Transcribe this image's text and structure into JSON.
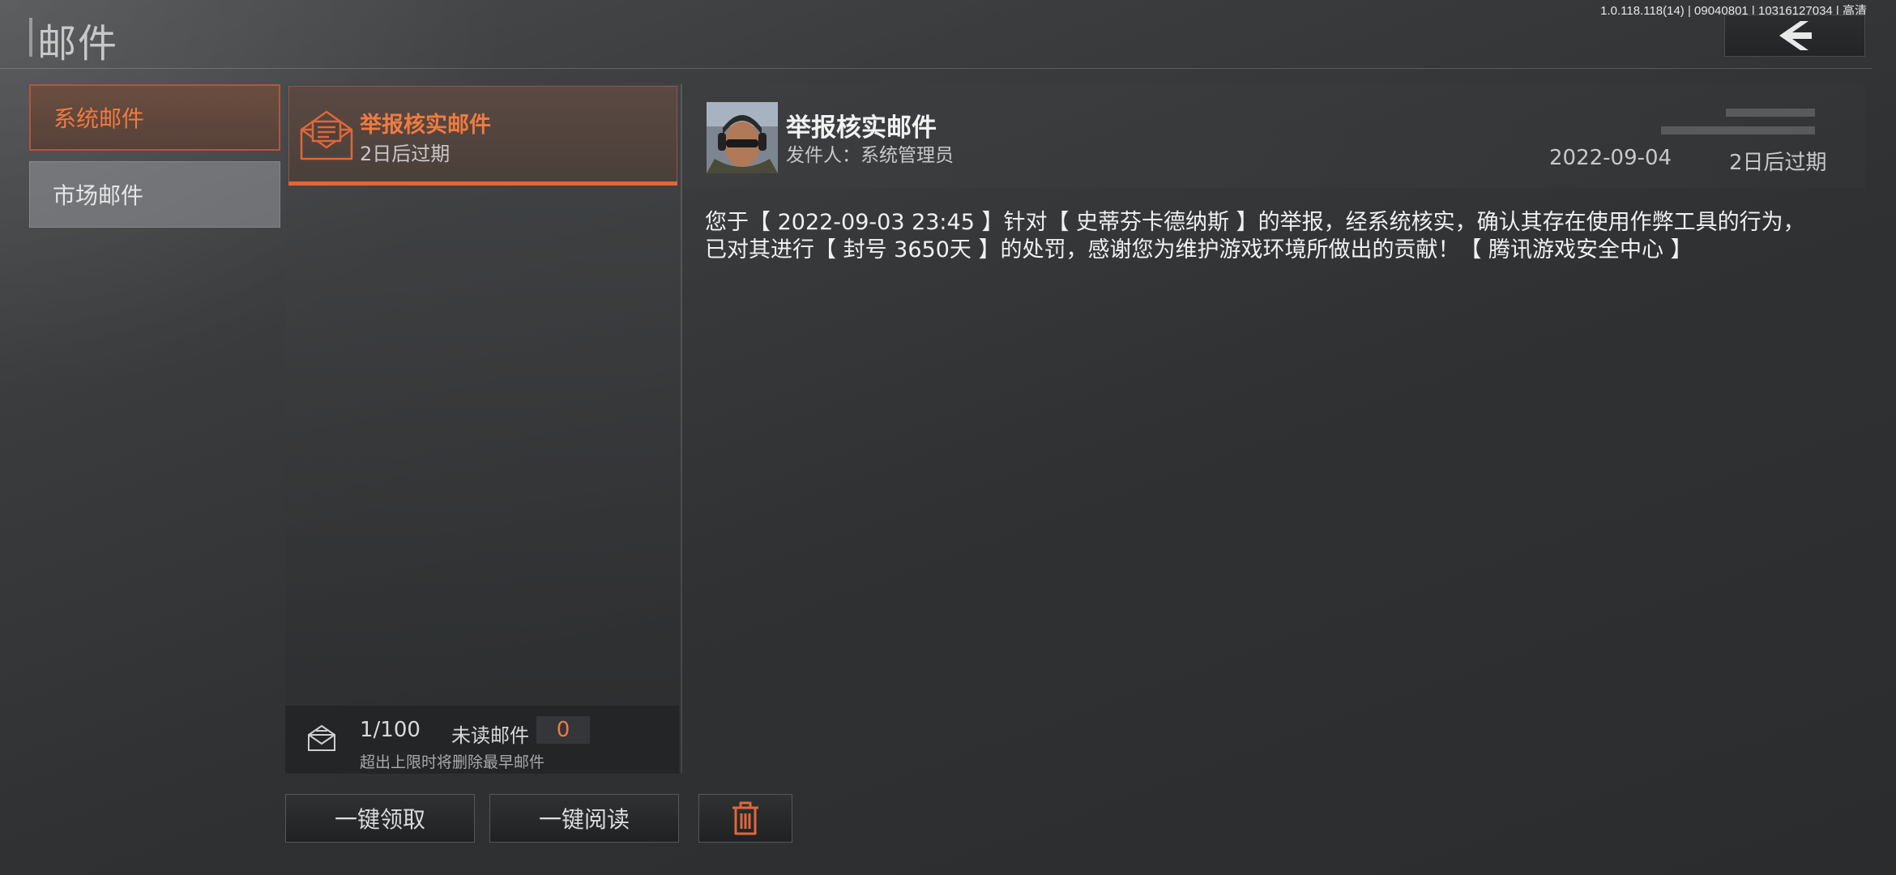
{
  "header": {
    "title": "邮件",
    "version": "1.0.118.118(14) | 09040801 | 10316127034 | 高清",
    "back_icon": "chevron-left-icon"
  },
  "tabs": [
    {
      "label": "系统邮件",
      "active": true
    },
    {
      "label": "市场邮件",
      "active": false
    }
  ],
  "mail_list": [
    {
      "title": "举报核实邮件",
      "expiry": "2日后过期",
      "icon": "envelope-open-icon",
      "selected": true
    }
  ],
  "capacity": {
    "count": "1/100",
    "unread_label": "未读邮件",
    "unread_count": "0",
    "note": "超出上限时将删除最早邮件",
    "icon": "mailbox-icon"
  },
  "actions": {
    "claim_all": "一键领取",
    "read_all": "一键阅读",
    "delete_icon": "trash-icon"
  },
  "detail": {
    "title": "举报核实邮件",
    "sender": "发件人：系统管理员",
    "date": "2022-09-04",
    "expiry": "2日后过期",
    "body": "您于【 2022-09-03 23:45 】针对【 史蒂芬卡德纳斯 】的举报，经系统核实，确认其存在使用作弊工具的行为，已对其进行【 封号 3650天 】的处罚，感谢您为维护游戏环境所做出的贡献！【 腾讯游戏安全中心 】"
  },
  "colors": {
    "accent": "#f07a40",
    "accent_border": "#b2563a",
    "underline": "#e0673a"
  }
}
